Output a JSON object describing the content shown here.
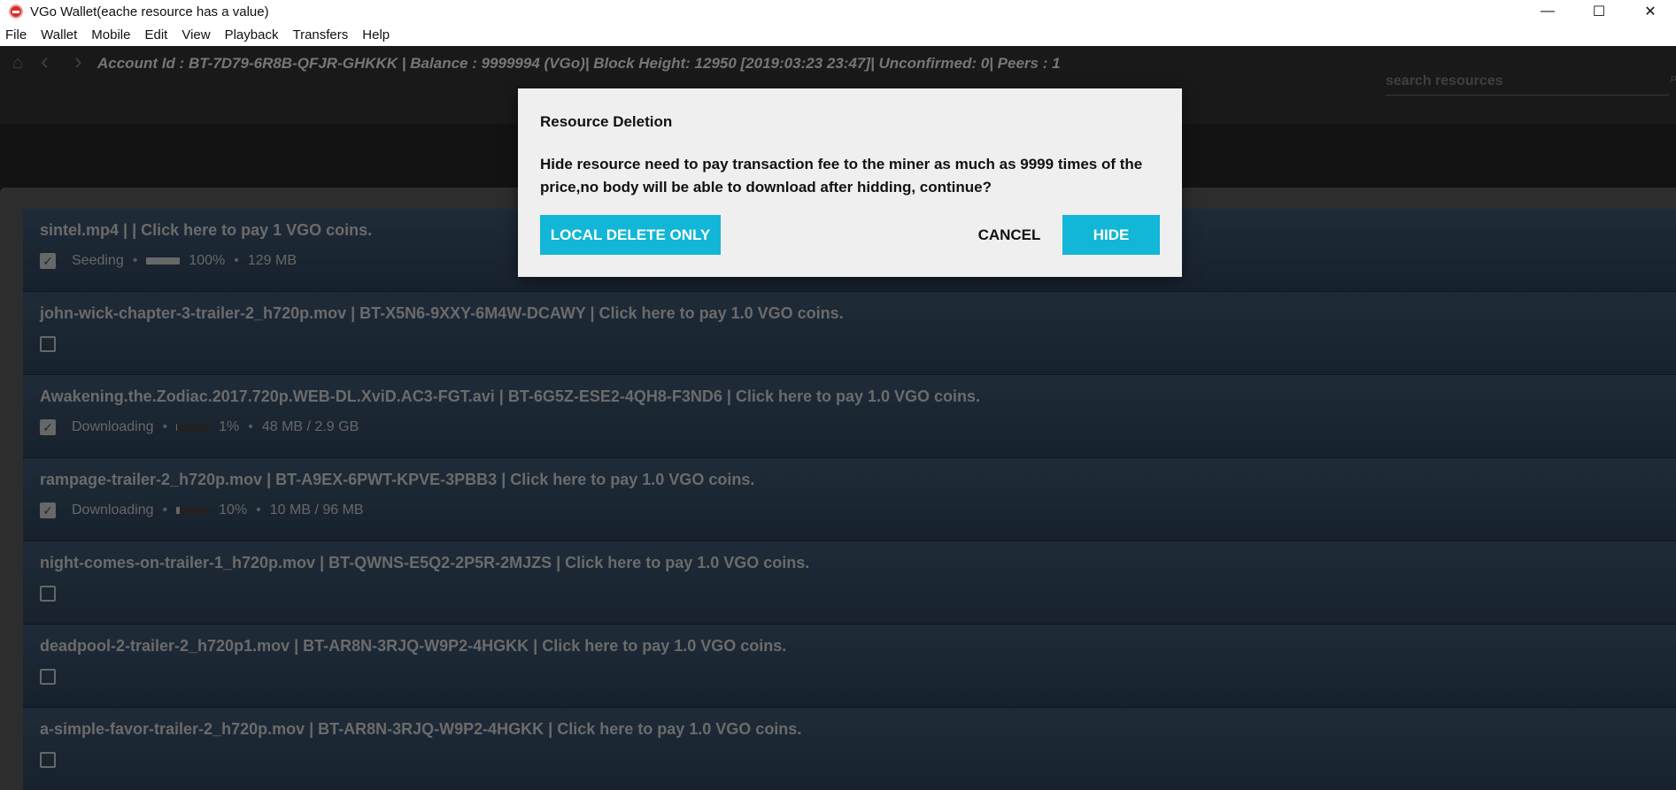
{
  "window": {
    "title": "VGo Wallet(eache resource has a value)",
    "minimize": "—",
    "maximize": "☐",
    "close": "✕"
  },
  "menu": [
    "File",
    "Wallet",
    "Mobile",
    "Edit",
    "View",
    "Playback",
    "Transfers",
    "Help"
  ],
  "nav": {
    "home_icon": "⌂",
    "back_icon": "‹",
    "forward_icon": "›",
    "status": "Account Id : BT-7D79-6R8B-QFJR-GHKKK | Balance : 9999994 (VGo)| Block Height: 12950 [2019:03:23 23:47]| Unconfirmed: 0| Peers : 1",
    "search_placeholder": "search resources",
    "search_icon": "⌕"
  },
  "rows": [
    {
      "title": "sintel.mp4 | | Click here to pay 1 VGO coins.",
      "checked": true,
      "status": "Seeding",
      "progress": 100,
      "percent": "100%",
      "size": "129 MB"
    },
    {
      "title": "john-wick-chapter-3-trailer-2_h720p.mov | BT-X5N6-9XXY-6M4W-DCAWY | Click here to pay 1.0 VGO coins.",
      "checked": false
    },
    {
      "title": "Awakening.the.Zodiac.2017.720p.WEB-DL.XviD.AC3-FGT.avi | BT-6G5Z-ESE2-4QH8-F3ND6 | Click here to pay 1.0 VGO coins.",
      "checked": true,
      "status": "Downloading",
      "progress": 1,
      "percent": "1%",
      "size": "48 MB / 2.9 GB"
    },
    {
      "title": "rampage-trailer-2_h720p.mov | BT-A9EX-6PWT-KPVE-3PBB3 | Click here to pay 1.0 VGO coins.",
      "checked": true,
      "status": "Downloading",
      "progress": 10,
      "percent": "10%",
      "size": "10 MB / 96 MB"
    },
    {
      "title": "night-comes-on-trailer-1_h720p.mov | BT-QWNS-E5Q2-2P5R-2MJZS | Click here to pay 1.0 VGO coins.",
      "checked": false
    },
    {
      "title": "deadpool-2-trailer-2_h720p1.mov | BT-AR8N-3RJQ-W9P2-4HGKK | Click here to pay 1.0 VGO coins.",
      "checked": false
    },
    {
      "title": "a-simple-favor-trailer-2_h720p.mov | BT-AR8N-3RJQ-W9P2-4HGKK | Click here to pay 1.0 VGO coins.",
      "checked": false
    }
  ],
  "dialog": {
    "title": "Resource Deletion",
    "message": "Hide resource need to pay transaction fee to the miner as much as 9999 times of the price,no body will be able to download after hidding, continue?",
    "local_delete_label": "LOCAL DELETE ONLY",
    "cancel_label": "CANCEL",
    "hide_label": "HIDE"
  },
  "separator": "•",
  "colors": {
    "accent": "#12b6d6",
    "row_bg": "#24344a",
    "dialog_bg": "#efefef"
  }
}
